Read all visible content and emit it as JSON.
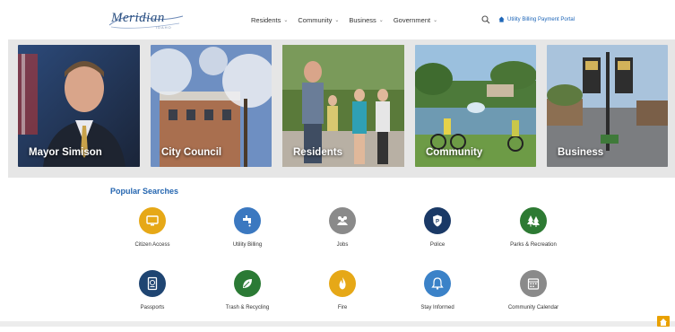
{
  "header": {
    "logo_text": "Meridian",
    "logo_sub": "IDAHO",
    "nav": [
      {
        "label": "Residents"
      },
      {
        "label": "Community"
      },
      {
        "label": "Business"
      },
      {
        "label": "Government"
      }
    ],
    "portal_link": "Utility Billing Payment Portal",
    "search_icon": "search-icon",
    "home_icon": "home-icon"
  },
  "hero": {
    "cards": [
      {
        "label": "Mayor Simison"
      },
      {
        "label": "City Council"
      },
      {
        "label": "Residents"
      },
      {
        "label": "Community"
      },
      {
        "label": "Business"
      }
    ]
  },
  "popular": {
    "title": "Popular Searches",
    "items": [
      {
        "label": "Citizen Access",
        "color": "#e6a817",
        "icon": "monitor-icon"
      },
      {
        "label": "Utility Billing",
        "color": "#3b78c0",
        "icon": "faucet-icon"
      },
      {
        "label": "Jobs",
        "color": "#8a8a8a",
        "icon": "people-icon"
      },
      {
        "label": "Police",
        "color": "#1a3966",
        "icon": "badge-icon"
      },
      {
        "label": "Parks & Recreation",
        "color": "#2d7a33",
        "icon": "tree-icon"
      },
      {
        "label": "Passports",
        "color": "#1f4572",
        "icon": "passport-icon"
      },
      {
        "label": "Trash & Recycling",
        "color": "#2b7a35",
        "icon": "leaf-icon"
      },
      {
        "label": "Fire",
        "color": "#e6a817",
        "icon": "flame-icon"
      },
      {
        "label": "Stay Informed",
        "color": "#3b82c8",
        "icon": "bell-icon"
      },
      {
        "label": "Community Calendar",
        "color": "#8a8a8a",
        "icon": "calendar-icon"
      }
    ]
  }
}
